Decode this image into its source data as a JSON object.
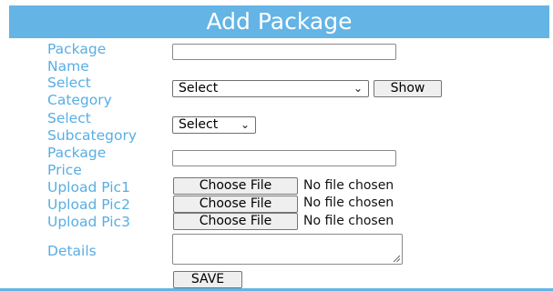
{
  "form": {
    "title": "Add Package",
    "labels": {
      "package_name": [
        "Package",
        "Name"
      ],
      "category": [
        "Select",
        "Category"
      ],
      "subcategory": [
        "Select",
        "Subcategory"
      ],
      "price": [
        "Package",
        "Price"
      ],
      "pic1": "Upload Pic1",
      "pic2": "Upload Pic2",
      "pic3": "Upload Pic3",
      "details": "Details"
    },
    "category_select": {
      "value": "Select",
      "show_label": "Show"
    },
    "subcategory_select": {
      "value": "Select"
    },
    "uploads": {
      "choose_label": "Choose File",
      "no_file_text": "No file chosen"
    },
    "save_label": "SAVE",
    "package_name_value": "",
    "price_value": "",
    "details_value": ""
  },
  "colors": {
    "accent": "#64b4e6",
    "label": "#58aee4"
  }
}
